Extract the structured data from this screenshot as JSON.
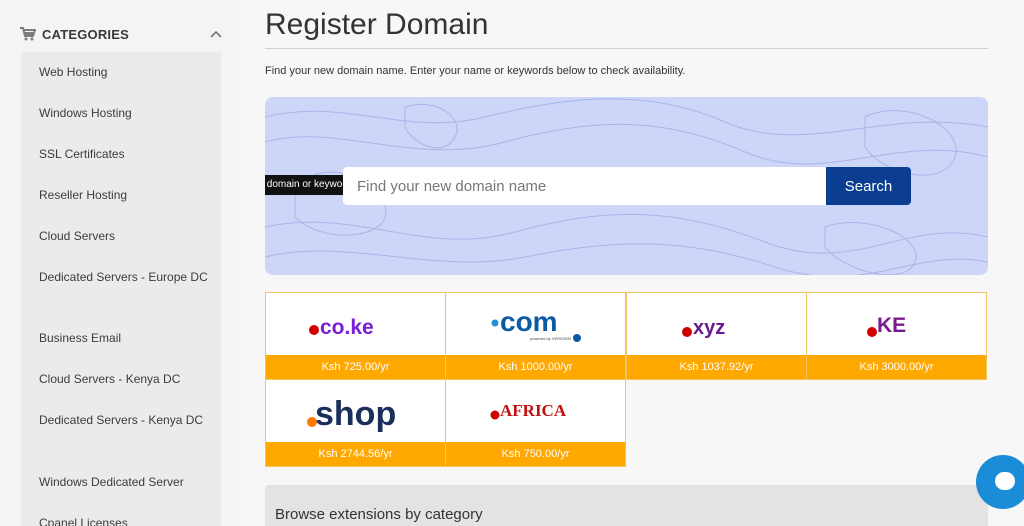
{
  "sidebar": {
    "header": "CATEGORIES",
    "items": [
      "Web Hosting",
      "Windows Hosting",
      "SSL Certificates",
      "Reseller Hosting",
      "Cloud Servers",
      "Dedicated Servers - Europe DC",
      "Business Email",
      "Cloud Servers - Kenya DC",
      "Dedicated Servers - Kenya DC",
      "Windows Dedicated Server",
      "Cpanel Licenses"
    ]
  },
  "main": {
    "title": "Register Domain",
    "lead": "Find your new domain name. Enter your name or keywords below to check availability.",
    "search": {
      "tooltip": "Enter a domain or keyword",
      "placeholder": "Find your new domain name",
      "button": "Search"
    },
    "tlds": [
      {
        "name": ".co.ke",
        "logo_text": "co.ke",
        "price": "Ksh 725.00/yr"
      },
      {
        "name": ".com",
        "logo_text": "com",
        "sub": "powered by VERISIGN",
        "price": "Ksh 1000.00/yr"
      },
      {
        "name": ".xyz",
        "logo_text": "xyz",
        "price": "Ksh 1037.92/yr"
      },
      {
        "name": ".KE",
        "logo_text": "KE",
        "price": "Ksh 3000.00/yr"
      },
      {
        "name": ".shop",
        "logo_text": "shop",
        "price": "Ksh 2744.56/yr"
      },
      {
        "name": ".AFRICA",
        "logo_text": "AFRICA",
        "price": "Ksh 750.00/yr"
      }
    ],
    "browse_title": "Browse extensions by category"
  },
  "colors": {
    "accent_blue": "#0b3d91",
    "price_bar": "#ffa800",
    "panel_bg": "#cdd5f8",
    "chat_blue": "#1a8cd8"
  },
  "icons": {
    "cart": "cart-icon",
    "collapse": "chevron-up-icon",
    "chat": "chat-icon"
  }
}
